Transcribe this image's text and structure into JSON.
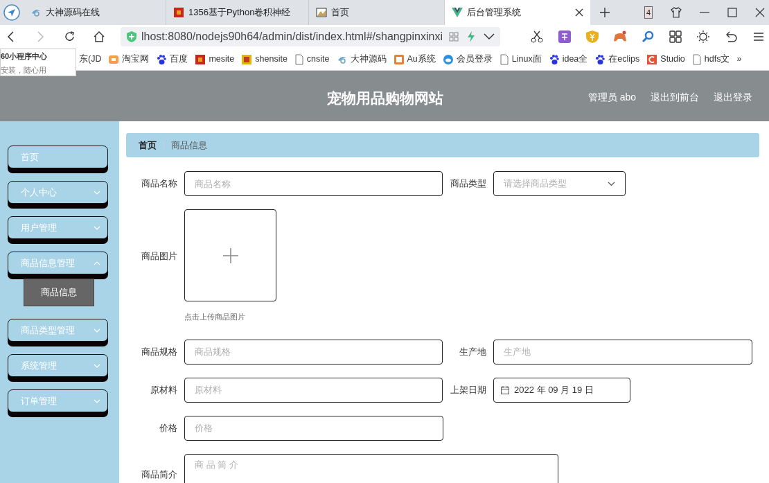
{
  "browser": {
    "tabs": [
      {
        "title": "大神源码在线",
        "selected": false
      },
      {
        "title": "1356基于Python卷积神经",
        "selected": false
      },
      {
        "title": "首页",
        "selected": false
      },
      {
        "title": "后台管理系统",
        "selected": true
      }
    ],
    "tab_count": "4",
    "address": "lhost:8080/nodejs90h64/admin/dist/index.html#/shangpinxinxi",
    "bookmarks": [
      "东(JD",
      "淘宝网",
      "百度",
      "mesite",
      "shensite",
      "cnsite",
      "大神源码",
      "Au系统",
      "会员登录",
      "Linux面",
      "idea全",
      "在eclips",
      "Studio",
      "hdfs文"
    ],
    "more": "»",
    "popup": {
      "title": "60小程序中心",
      "subtitle": "安装，随心用"
    }
  },
  "app": {
    "title": "宠物用品购物网站",
    "header_links": [
      "管理员 abo",
      "退出到前台",
      "退出登录"
    ],
    "sidebar": [
      {
        "label": "首页",
        "expandable": false
      },
      {
        "label": "个人中心",
        "expandable": true,
        "expanded": false
      },
      {
        "label": "用户管理",
        "expandable": true,
        "expanded": false
      },
      {
        "label": "商品信息管理",
        "expandable": true,
        "expanded": true,
        "children": [
          {
            "label": "商品信息",
            "selected": true
          }
        ]
      },
      {
        "label": "商品类型管理",
        "expandable": true,
        "expanded": false
      },
      {
        "label": "系统管理",
        "expandable": true,
        "expanded": false
      },
      {
        "label": "订单管理",
        "expandable": true,
        "expanded": false
      }
    ],
    "breadcrumb": [
      "首页",
      "商品信息"
    ],
    "form_rows": [
      [
        {
          "kind": "text",
          "label": "商品名称",
          "placeholder": "商品名称"
        },
        {
          "kind": "select",
          "label": "商品类型",
          "placeholder": "请选择商品类型"
        }
      ],
      [
        {
          "kind": "image",
          "label": "商品图片",
          "hint": "点击上传商品图片"
        }
      ],
      [
        {
          "kind": "text",
          "label": "商品规格",
          "placeholder": "商品规格"
        },
        {
          "kind": "text",
          "label": "生产地",
          "placeholder": "生产地"
        }
      ],
      [
        {
          "kind": "text",
          "label": "原材料",
          "placeholder": "原材料"
        },
        {
          "kind": "date",
          "label": "上架日期",
          "value": "2022 年 09 月 19 日"
        }
      ],
      [
        {
          "kind": "text",
          "label": "价格",
          "placeholder": "价格"
        }
      ],
      [
        {
          "kind": "textarea",
          "label": "商品简介",
          "placeholder": "商 品 简 介"
        }
      ]
    ]
  }
}
